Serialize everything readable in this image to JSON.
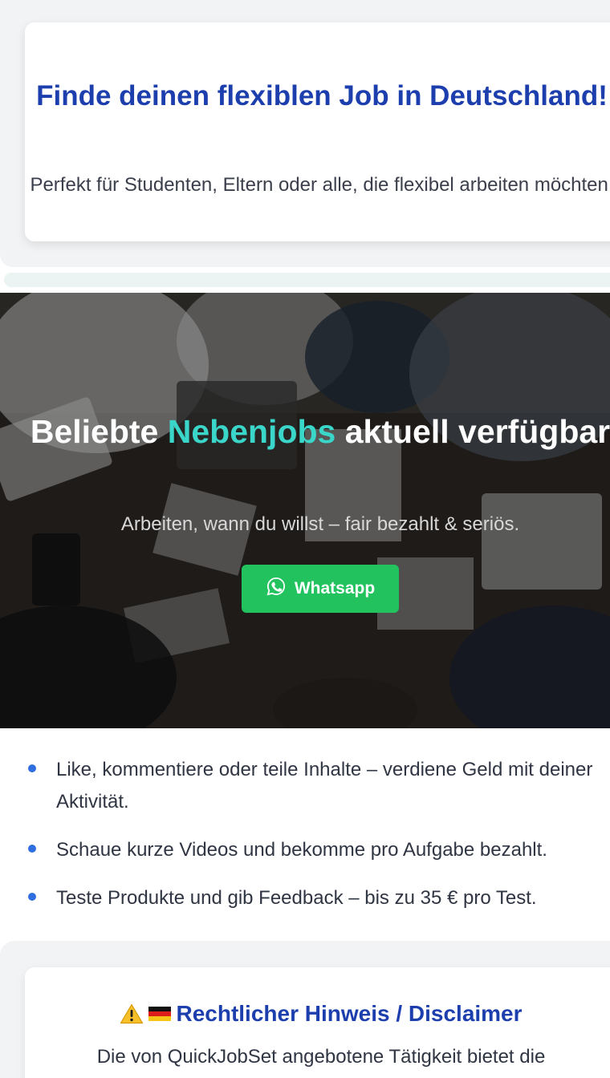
{
  "intro": {
    "title": "Finde deinen flexiblen Job in Deutschland!",
    "text": "Perfekt für Studenten, Eltern oder alle, die flexibel arbeiten möchten."
  },
  "hero": {
    "title_part1": "Beliebte",
    "title_highlight": "Nebenjobs",
    "title_part2": "aktuell verfügbar",
    "subtitle": "Arbeiten, wann du willst – fair bezahlt & seriös.",
    "button_label": "Whatsapp",
    "button_icon": "whatsapp-icon",
    "accent_color": "#3ad6c9",
    "button_color": "#22c35e"
  },
  "features": [
    "Like, kommentiere oder teile Inhalte – verdiene Geld mit deiner Aktivität.",
    "Schaue kurze Videos und bekomme pro Aufgabe bezahlt.",
    "Teste Produkte und gib Feedback – bis zu 35 € pro Test."
  ],
  "disclaimer": {
    "icons": [
      "warning-icon",
      "german-flag-icon"
    ],
    "heading": "Rechtlicher Hinweis / Disclaimer",
    "text": "Die von QuickJobSet angebotene Tätigkeit bietet die"
  },
  "colors": {
    "heading_blue": "#1d3fae",
    "bullet_blue": "#2f6fe0",
    "section_gray": "#f2f3f5"
  }
}
